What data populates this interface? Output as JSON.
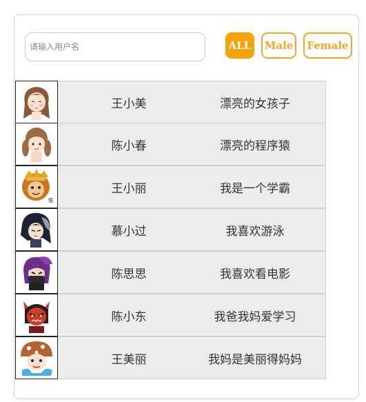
{
  "search": {
    "placeholder": "请输入用户名",
    "value": ""
  },
  "filters": {
    "all": "ALL",
    "male": "Male",
    "female": "Female",
    "active": "all"
  },
  "users": [
    {
      "name": "王小美",
      "desc": "漂亮的女孩子",
      "avatar": "girl-long-hair-avatar"
    },
    {
      "name": "陈小春",
      "desc": "漂亮的程序猿",
      "avatar": "girl-pigtails-avatar"
    },
    {
      "name": "王小丽",
      "desc": "我是一个学霸",
      "avatar": "monkey-king-avatar"
    },
    {
      "name": "慕小过",
      "desc": "我喜欢游泳",
      "avatar": "dark-hair-warrior-avatar"
    },
    {
      "name": "陈思思",
      "desc": "我喜欢看电影",
      "avatar": "masked-ninja-avatar"
    },
    {
      "name": "陈小东",
      "desc": "我爸我妈爱学习",
      "avatar": "red-demon-avatar"
    },
    {
      "name": "王美丽",
      "desc": "我妈是美丽得妈妈",
      "avatar": "mushroom-kid-avatar"
    }
  ],
  "colors": {
    "accent": "#f5a30a",
    "row_bg": "#ececec"
  }
}
